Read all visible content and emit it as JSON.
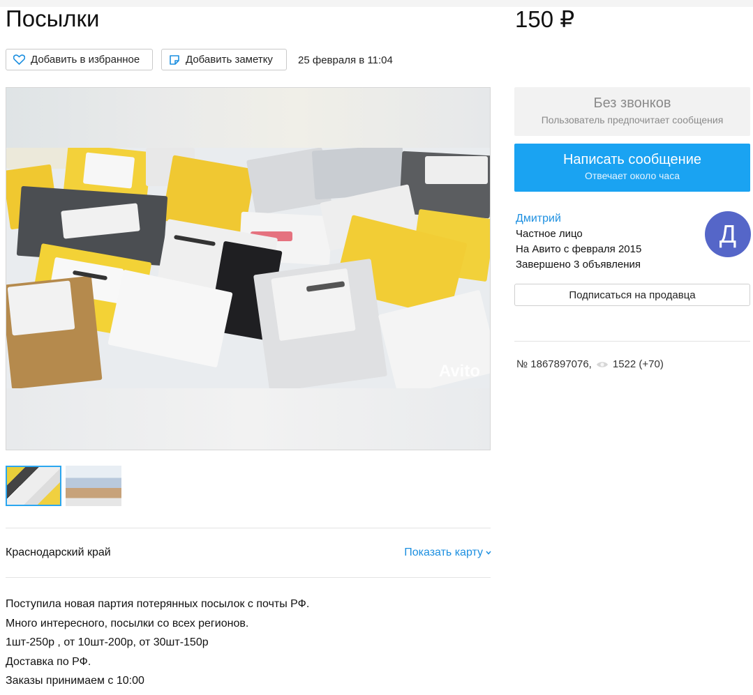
{
  "listing": {
    "title": "Посылки",
    "price": "150 ₽",
    "date": "25 февраля в 11:04",
    "actions": {
      "favorite_label": "Добавить в избранное",
      "note_label": "Добавить заметку"
    },
    "photo_watermark": "Avito",
    "location": {
      "region": "Краснодарский край",
      "show_map_label": "Показать карту"
    },
    "description": [
      "Поступила новая партия потерянных посылок с почты РФ.",
      "Много интересного, посылки со всех регионов.",
      "1шт-250р , от 10шт-200р, от 30шт-150р",
      "Доставка по РФ.",
      "Заказы принимаем с 10:00"
    ]
  },
  "contact": {
    "no_calls": {
      "title": "Без звонков",
      "subtitle": "Пользователь предпочитает сообщения"
    },
    "message_button": {
      "title": "Написать сообщение",
      "subtitle": "Отвечает около часа"
    }
  },
  "seller": {
    "name": "Дмитрий",
    "type": "Частное лицо",
    "since": "На Авито с февраля 2015",
    "completed": "Завершено 3 объявления",
    "avatar_letter": "Д",
    "subscribe_label": "Подписаться на продавца"
  },
  "stats": {
    "id_label": "№ 1867897076,",
    "views": "1522 (+70)"
  },
  "colors": {
    "accent": "#1aa3f2",
    "link": "#1c8fe0",
    "avatar": "#5566c8"
  }
}
